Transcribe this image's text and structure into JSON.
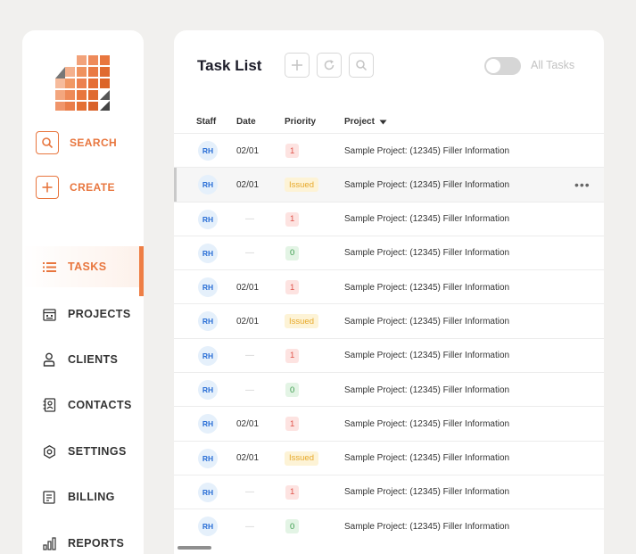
{
  "sidebar": {
    "actions": [
      {
        "label": "SEARCH",
        "icon": "search-icon"
      },
      {
        "label": "CREATE",
        "icon": "plus-icon"
      }
    ],
    "items": [
      {
        "label": "TASKS",
        "icon": "list-icon",
        "active": true
      },
      {
        "label": "PROJECTS",
        "icon": "calendar-icon"
      },
      {
        "label": "CLIENTS",
        "icon": "user-icon"
      },
      {
        "label": "CONTACTS",
        "icon": "contact-book-icon"
      },
      {
        "label": "SETTINGS",
        "icon": "gear-icon"
      },
      {
        "label": "BILLING",
        "icon": "receipt-icon"
      },
      {
        "label": "REPORTS",
        "icon": "bar-chart-icon"
      }
    ]
  },
  "main": {
    "title": "Task List",
    "toolbar": [
      "plus-icon",
      "refresh-icon",
      "search-icon"
    ],
    "toggle_label": "All Tasks",
    "toggle_on": false,
    "columns": {
      "staff": "Staff",
      "date": "Date",
      "priority": "Priority",
      "project": "Project"
    },
    "rows": [
      {
        "staff": "RH",
        "date": "02/01",
        "priority": "1",
        "project": "Sample Project: (12345) Filler Information"
      },
      {
        "staff": "RH",
        "date": "02/01",
        "priority": "Issued",
        "project": "Sample Project: (12345) Filler Information",
        "more": "•••"
      },
      {
        "staff": "RH",
        "date": "—",
        "priority": "1",
        "project": "Sample Project: (12345) Filler Information"
      },
      {
        "staff": "RH",
        "date": "—",
        "priority": "0",
        "project": "Sample Project: (12345) Filler Information"
      },
      {
        "staff": "RH",
        "date": "02/01",
        "priority": "1",
        "project": "Sample Project: (12345) Filler Information"
      },
      {
        "staff": "RH",
        "date": "02/01",
        "priority": "Issued",
        "project": "Sample Project: (12345) Filler Information"
      },
      {
        "staff": "RH",
        "date": "—",
        "priority": "1",
        "project": "Sample Project: (12345) Filler Information"
      },
      {
        "staff": "RH",
        "date": "—",
        "priority": "0",
        "project": "Sample Project: (12345) Filler Information"
      },
      {
        "staff": "RH",
        "date": "02/01",
        "priority": "1",
        "project": "Sample Project: (12345) Filler Information"
      },
      {
        "staff": "RH",
        "date": "02/01",
        "priority": "Issued",
        "project": "Sample Project: (12345) Filler Information"
      },
      {
        "staff": "RH",
        "date": "—",
        "priority": "1",
        "project": "Sample Project: (12345) Filler Information"
      },
      {
        "staff": "RH",
        "date": "—",
        "priority": "0",
        "project": "Sample Project: (12345) Filler Information"
      }
    ]
  },
  "colors": {
    "accent": "#e8763e",
    "badge_red": "#e0544b",
    "badge_green": "#3a9b4c",
    "badge_yellow": "#e7a92b",
    "avatar": "#2b6fd6"
  }
}
